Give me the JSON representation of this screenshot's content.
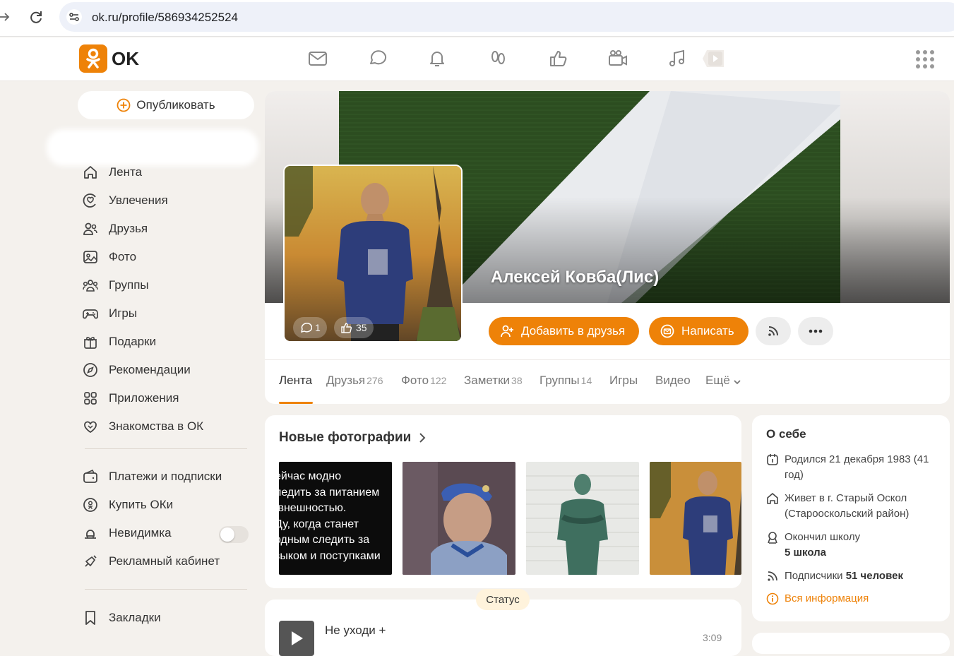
{
  "browser": {
    "url": "ok.ru/profile/586934252524"
  },
  "header": {
    "logo_text": "OK",
    "nav_icons": [
      "mail-icon",
      "discussions-icon",
      "notifications-icon",
      "guests-icon",
      "likes-icon",
      "video-icon",
      "music-icon",
      "video-player-icon"
    ],
    "accent_color": "#ee8208"
  },
  "sidebar": {
    "publish_label": "Опубликовать",
    "items": [
      {
        "label": "Лента",
        "icon": "home-icon"
      },
      {
        "label": "Увлечения",
        "icon": "hobbies-icon"
      },
      {
        "label": "Друзья",
        "icon": "friends-icon"
      },
      {
        "label": "Фото",
        "icon": "photo-icon"
      },
      {
        "label": "Группы",
        "icon": "groups-icon"
      },
      {
        "label": "Игры",
        "icon": "gamepad-icon"
      },
      {
        "label": "Подарки",
        "icon": "gift-icon"
      },
      {
        "label": "Рекомендации",
        "icon": "compass-icon"
      },
      {
        "label": "Приложения",
        "icon": "apps-icon"
      },
      {
        "label": "Знакомства в ОК",
        "icon": "dating-icon"
      }
    ],
    "items2": [
      {
        "label": "Платежи и подписки",
        "icon": "wallet-icon"
      },
      {
        "label": "Купить ОКи",
        "icon": "ok-coin-icon"
      },
      {
        "label": "Невидимка",
        "icon": "invisible-icon",
        "toggle": false
      },
      {
        "label": "Рекламный кабинет",
        "icon": "ads-icon"
      }
    ],
    "items3": [
      {
        "label": "Закладки",
        "icon": "bookmark-icon"
      }
    ]
  },
  "profile": {
    "name": "Алексей Ковба(Лис)",
    "avatar_comments": "1",
    "avatar_likes": "35",
    "add_friend_label": "Добавить в друзья",
    "write_label": "Написать",
    "tabs": [
      {
        "label": "Лента",
        "count": ""
      },
      {
        "label": "Друзья",
        "count": "276"
      },
      {
        "label": "Фото",
        "count": "122"
      },
      {
        "label": "Заметки",
        "count": "38"
      },
      {
        "label": "Группы",
        "count": "14"
      },
      {
        "label": "Игры",
        "count": ""
      },
      {
        "label": "Видео",
        "count": ""
      },
      {
        "label": "Ещё",
        "count": ""
      }
    ]
  },
  "new_photos": {
    "title": "Новые фотографии",
    "text_photo": "ейчас модно\nледить за питанием\n внешностью.\nДу, когда станет\nодным следить за\nзыком и поступками"
  },
  "about": {
    "title": "О себе",
    "born": "Родился 21 декабря 1983 (41 год)",
    "lives": "Живет в г. Старый Оскол (Старооскольский район)",
    "school_prefix": "Окончил школу",
    "school_name": "5 школа",
    "subs_prefix": "Подписчики",
    "subs_count": "51 человек",
    "all_info": "Вся информация"
  },
  "status": {
    "badge": "Статус",
    "track": "Не уходи +",
    "duration": "3:09"
  }
}
